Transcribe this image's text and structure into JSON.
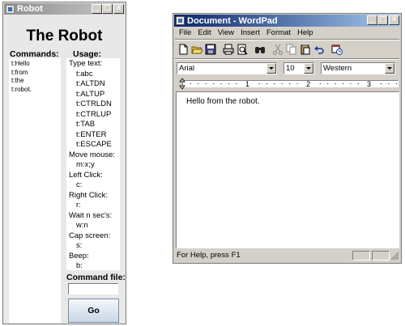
{
  "robot": {
    "window_title": "Robot",
    "heading": "The Robot",
    "commands_header": "Commands:",
    "usage_header": "Usage:",
    "commands": [
      "t:Hello",
      "t:from",
      "t:the",
      "t:robot."
    ],
    "usage": [
      {
        "section": "Type text:",
        "items": [
          "t:abc",
          "t:ALTDN",
          "t:ALTUP",
          "t:CTRLDN",
          "t:CTRLUP",
          "t:TAB",
          "t:ENTER",
          "t:ESCAPE"
        ]
      },
      {
        "section": "Move mouse:",
        "items": [
          "m:x;y"
        ]
      },
      {
        "section": "Left Click:",
        "items": [
          "c:"
        ]
      },
      {
        "section": "Right Click:",
        "items": [
          "r:"
        ]
      },
      {
        "section": "Wait n sec's:",
        "items": [
          "w:n"
        ]
      },
      {
        "section": "Cap screen:",
        "items": [
          "s:"
        ]
      },
      {
        "section": "Beep:",
        "items": [
          "b:"
        ]
      }
    ],
    "command_file_label": "Command file:",
    "command_file_value": "",
    "go_label": "Go"
  },
  "wordpad": {
    "window_title": "Document - WordPad",
    "menu": [
      "File",
      "Edit",
      "View",
      "Insert",
      "Format",
      "Help"
    ],
    "font": "Arial",
    "size": "10",
    "script": "Western",
    "ruler_numbers": [
      "1",
      "2",
      "3"
    ],
    "document_text": "Hello from the robot.",
    "status": "For Help, press F1",
    "toolbar_icons": [
      "new-icon",
      "open-icon",
      "save-icon",
      "print-icon",
      "print-preview-icon",
      "find-icon",
      "cut-icon",
      "copy-icon",
      "paste-icon",
      "undo-icon",
      "insert-datetime-icon"
    ]
  },
  "window_controls": {
    "minimize": "_",
    "maximize": "□",
    "close": "×"
  }
}
